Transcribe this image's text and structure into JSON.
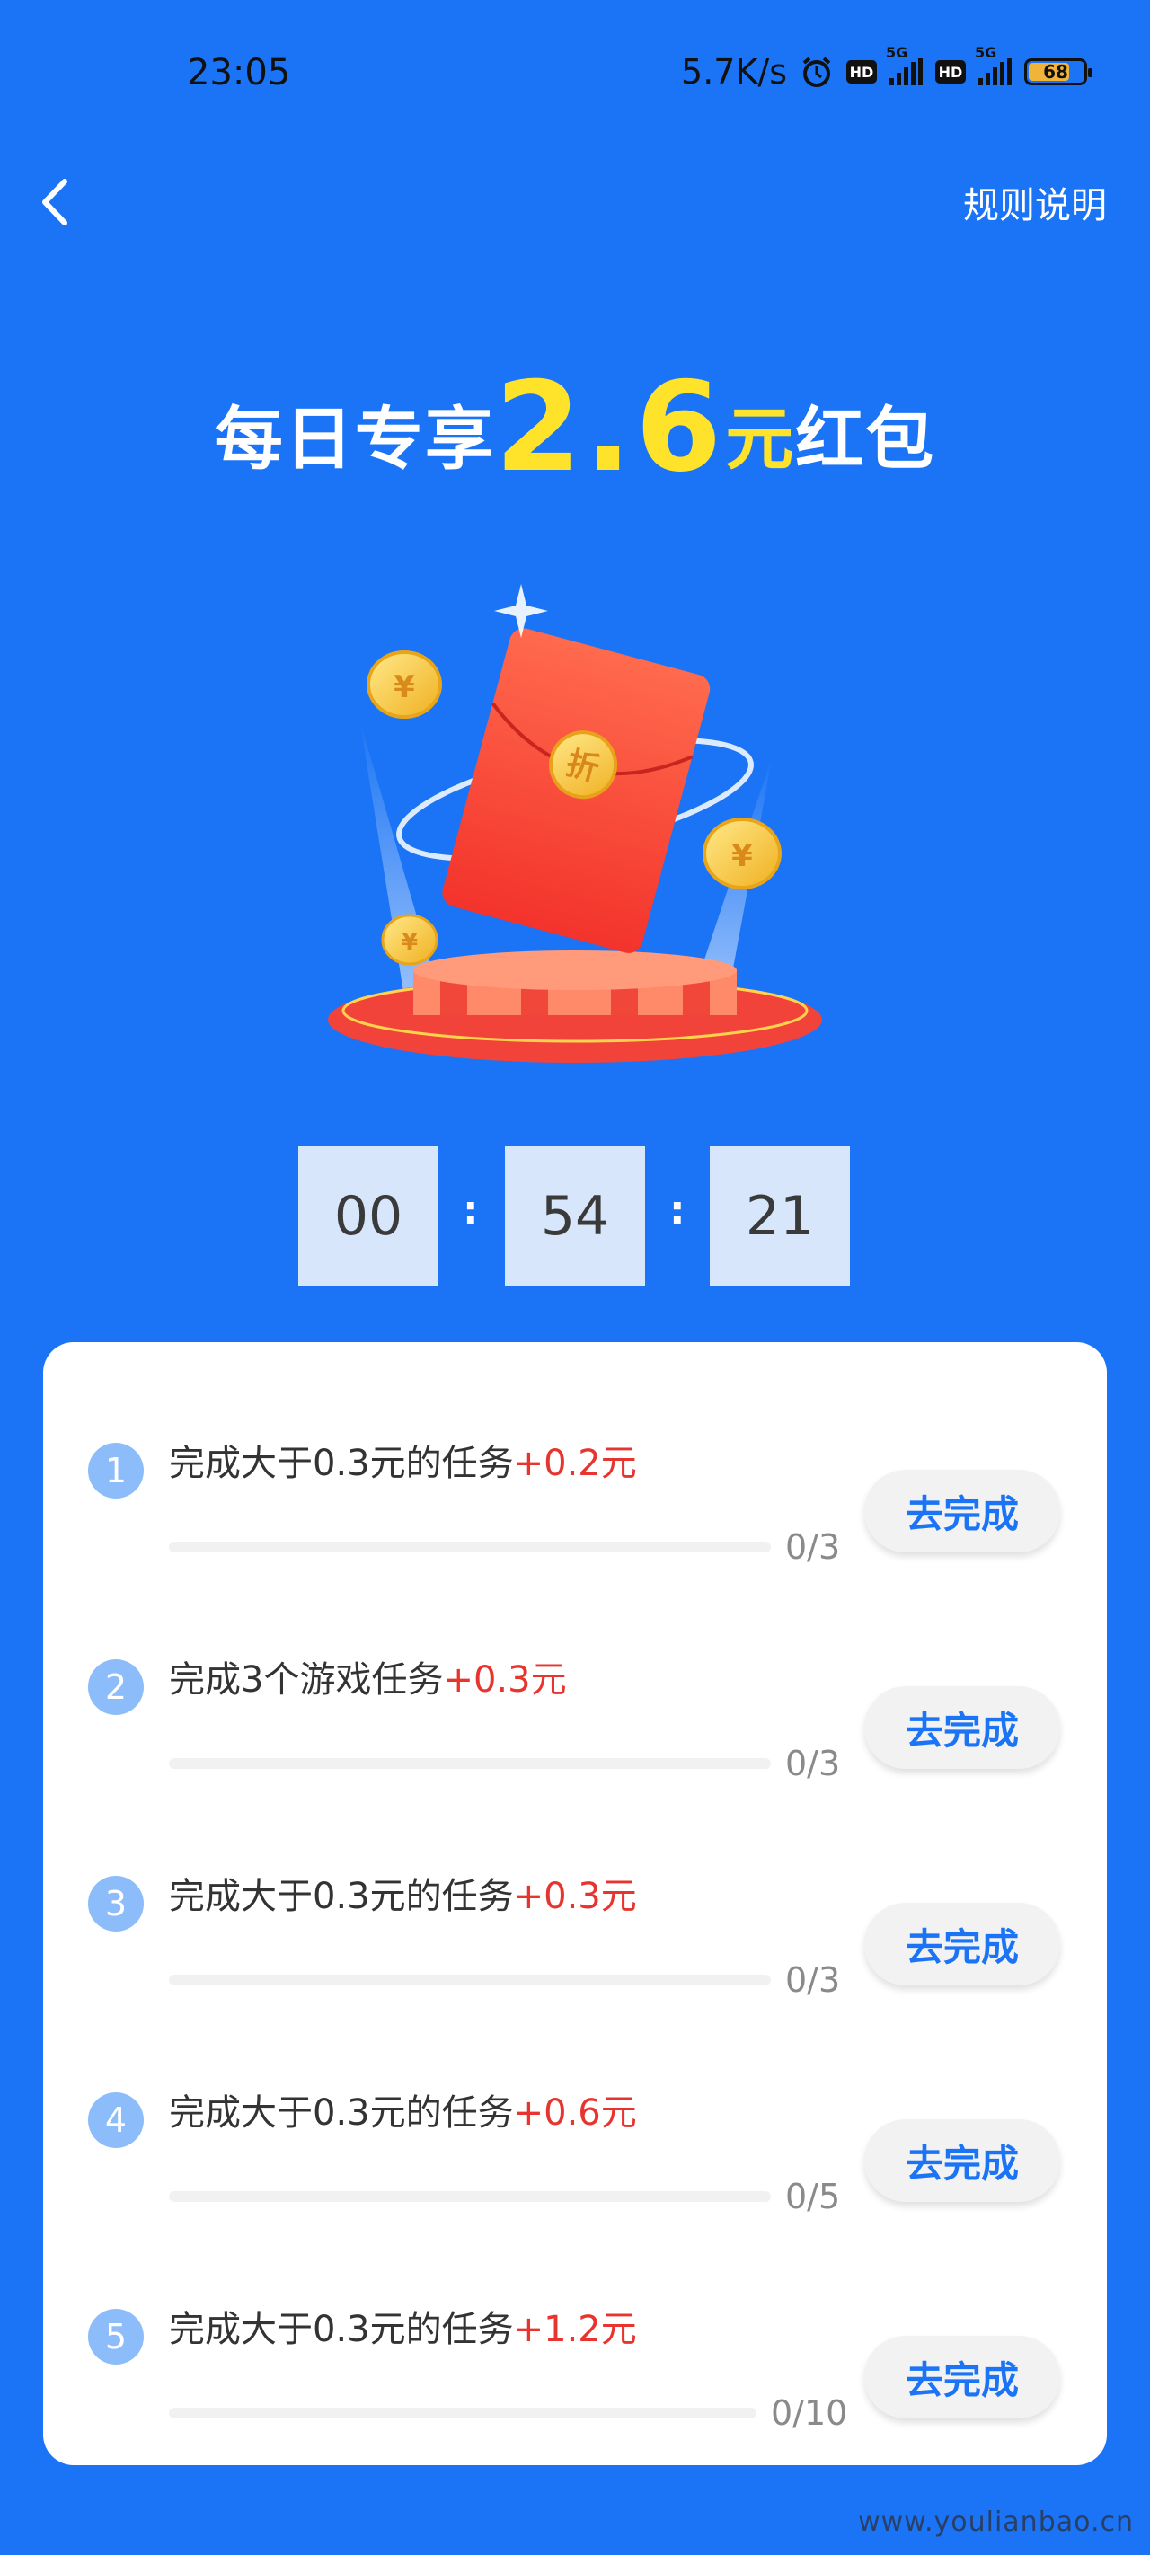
{
  "status_bar": {
    "time": "23:05",
    "net_speed": "5.7K/s",
    "hd_label": "HD",
    "network_label": "5G",
    "battery_level": "68",
    "icons": [
      "alarm-icon",
      "hd-icon",
      "signal-icon",
      "battery-icon"
    ]
  },
  "header": {
    "back_icon": "chevron-left-icon",
    "rules_label": "规则说明"
  },
  "headline": {
    "prefix": "每日专享",
    "amount": "2.6",
    "unit": "元",
    "suffix": "红包"
  },
  "illustration": {
    "envelope_label": "折",
    "coin_symbol": "¥"
  },
  "countdown": {
    "hours": "00",
    "minutes": "54",
    "seconds": "21",
    "separator": ":"
  },
  "tasks": [
    {
      "index": "1",
      "title": "完成大于0.3元的任务",
      "reward": "+0.2元",
      "progress": "0/3",
      "fraction": 0,
      "button": "去完成"
    },
    {
      "index": "2",
      "title": "完成3个游戏任务",
      "reward": "+0.3元",
      "progress": "0/3",
      "fraction": 0,
      "button": "去完成"
    },
    {
      "index": "3",
      "title": "完成大于0.3元的任务",
      "reward": "+0.3元",
      "progress": "0/3",
      "fraction": 0,
      "button": "去完成"
    },
    {
      "index": "4",
      "title": "完成大于0.3元的任务",
      "reward": "+0.6元",
      "progress": "0/5",
      "fraction": 0,
      "button": "去完成"
    },
    {
      "index": "5",
      "title": "完成大于0.3元的任务",
      "reward": "+1.2元",
      "progress": "0/10",
      "fraction": 0,
      "button": "去完成"
    }
  ],
  "watermark": "www.youlianbao.cn",
  "colors": {
    "background": "#1a74f5",
    "headline_accent": "#ffe32b",
    "reward": "#e8342f",
    "button_text": "#1a74f5"
  }
}
